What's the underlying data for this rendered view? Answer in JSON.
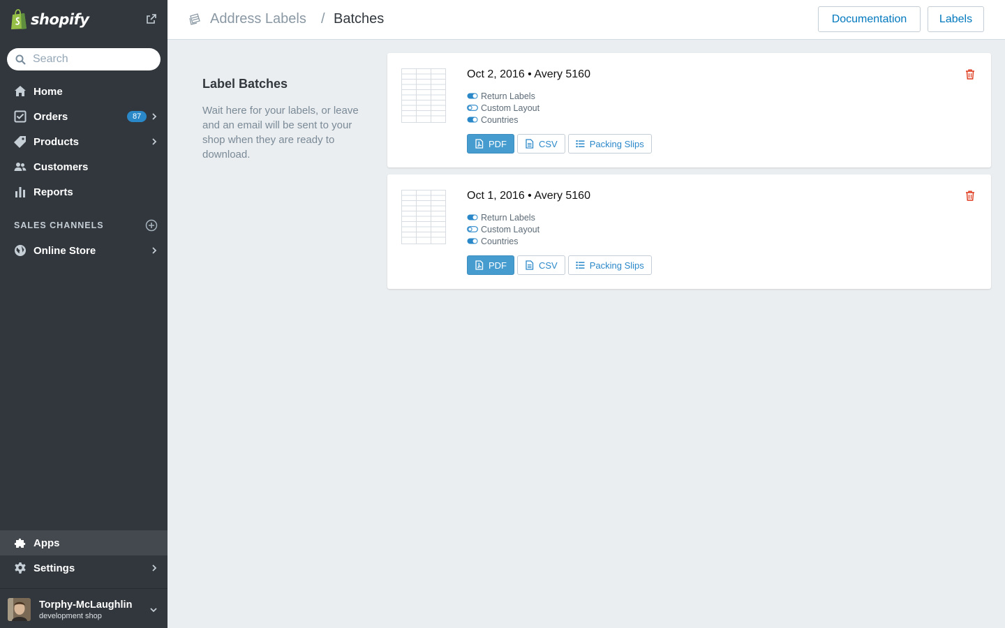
{
  "brand": {
    "name": "shopify",
    "color": "#95bf47"
  },
  "search": {
    "placeholder": "Search"
  },
  "nav": [
    {
      "label": "Home",
      "icon": "home-icon"
    },
    {
      "label": "Orders",
      "icon": "orders-icon",
      "badge": "87"
    },
    {
      "label": "Products",
      "icon": "tag-icon"
    },
    {
      "label": "Customers",
      "icon": "customers-icon"
    },
    {
      "label": "Reports",
      "icon": "bar-chart-icon"
    }
  ],
  "sales_channels": {
    "title": "SALES CHANNELS",
    "items": [
      {
        "label": "Online Store",
        "icon": "globe-icon"
      }
    ]
  },
  "bottom_nav": [
    {
      "label": "Apps",
      "icon": "puzzle-icon",
      "active": true
    },
    {
      "label": "Settings",
      "icon": "gear-icon"
    }
  ],
  "user": {
    "name": "Torphy-McLaughlin",
    "subtitle": "development shop"
  },
  "header": {
    "breadcrumb_parent": "Address Labels",
    "separator": "/",
    "breadcrumb_current": "Batches",
    "buttons": {
      "documentation": "Documentation",
      "labels": "Labels"
    }
  },
  "intro": {
    "title": "Label Batches",
    "text": "Wait here for your labels, or leave and an email will be sent to your shop when they are ready to download."
  },
  "batches": [
    {
      "title": "Oct 2, 2016 • Avery 5160",
      "options": [
        {
          "label": "Return Labels",
          "enabled": true
        },
        {
          "label": "Custom Layout",
          "enabled": false
        },
        {
          "label": "Countries",
          "enabled": true
        }
      ],
      "actions": {
        "pdf": "PDF",
        "csv": "CSV",
        "packing": "Packing Slips"
      }
    },
    {
      "title": "Oct 1, 2016 • Avery 5160",
      "options": [
        {
          "label": "Return Labels",
          "enabled": true
        },
        {
          "label": "Custom Layout",
          "enabled": false
        },
        {
          "label": "Countries",
          "enabled": true
        }
      ],
      "actions": {
        "pdf": "PDF",
        "csv": "CSV",
        "packing": "Packing Slips"
      }
    }
  ],
  "colors": {
    "sidebar": "#31373d",
    "accent": "#479ccf",
    "link": "#0078bd",
    "danger": "#de3618"
  }
}
